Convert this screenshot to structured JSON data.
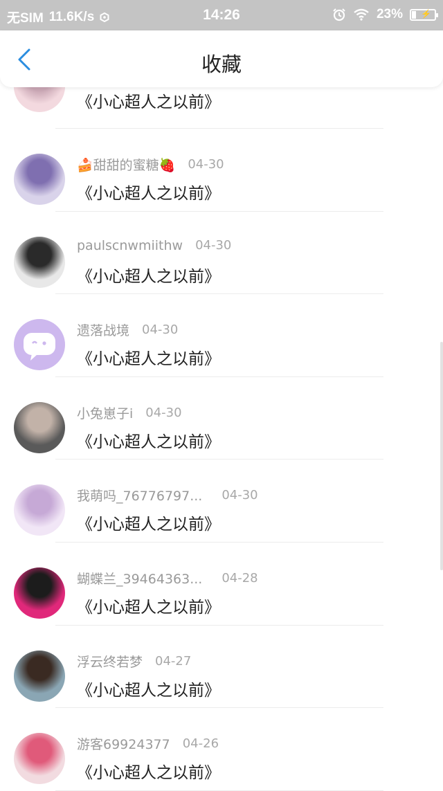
{
  "status_bar": {
    "carrier": "无SIM",
    "speed": "11.6K/s",
    "time": "14:26",
    "battery": "23%",
    "battery_level": 0.23,
    "icons": [
      "alarm-icon",
      "wifi-icon",
      "battery-icon"
    ]
  },
  "header": {
    "title": "收藏",
    "back_icon": "chevron-left-icon",
    "accent": "#2a8de0"
  },
  "comments": [
    {
      "user": "",
      "date": "",
      "text": "《小心超人之以前》",
      "avatar_colors": [
        "#f3d9df",
        "#c9a6b4"
      ]
    },
    {
      "user": "🍰甜甜的蜜糖🍓",
      "date": "04-30",
      "text": "《小心超人之以前》",
      "avatar_colors": [
        "#d9d3ea",
        "#7f6fb0"
      ]
    },
    {
      "user": "paulscnwmiithw",
      "date": "04-30",
      "text": "《小心超人之以前》",
      "avatar_colors": [
        "#e8e8e8",
        "#2a2a2a"
      ]
    },
    {
      "user": "遗落战境",
      "date": "04-30",
      "text": "《小心超人之以前》",
      "avatar_colors": [
        "#cdb8ee",
        "#ffffff"
      ]
    },
    {
      "user": "小兔崽子i",
      "date": "04-30",
      "text": "《小心超人之以前》",
      "avatar_colors": [
        "#5a5a5a",
        "#c2b2a8"
      ]
    },
    {
      "user": "我萌吗_76776797...",
      "date": "04-30",
      "text": "《小心超人之以前》",
      "avatar_colors": [
        "#f1e6f6",
        "#c6a9d6"
      ]
    },
    {
      "user": "蝴蝶兰_39464363...",
      "date": "04-28",
      "text": "《小心超人之以前》",
      "avatar_colors": [
        "#e0287a",
        "#1c1c1c"
      ]
    },
    {
      "user": "浮云终若梦",
      "date": "04-27",
      "text": "《小心超人之以前》",
      "avatar_colors": [
        "#8aa6b4",
        "#3a2a22"
      ]
    },
    {
      "user": "游客69924377",
      "date": "04-26",
      "text": "《小心超人之以前》",
      "avatar_colors": [
        "#f2dbe0",
        "#e05a7a"
      ]
    }
  ]
}
